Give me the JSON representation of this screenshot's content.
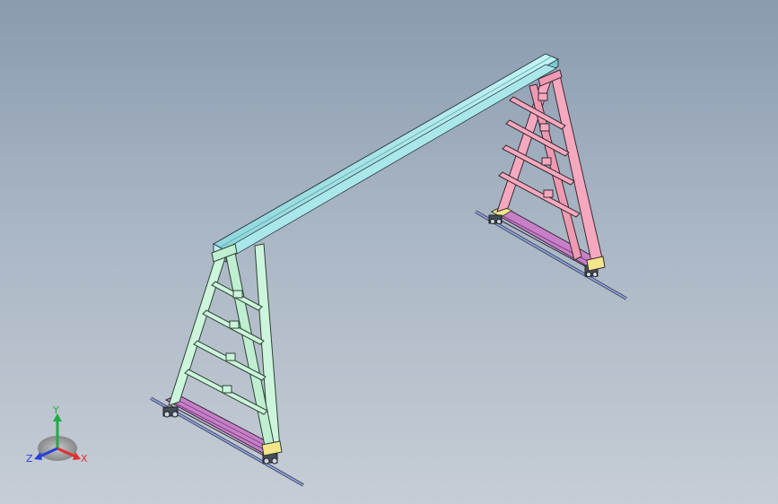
{
  "viewport": {
    "name": "cad-3d-viewport",
    "background_top": "#8a9bb0",
    "background_bottom": "#c6cdd6"
  },
  "model": {
    "beam_color": "#9fe3e6",
    "left_frame_color": "#cdf5dc",
    "right_frame_color": "#f6a9be",
    "base_plate_color": "#c780c8",
    "rail_color": "#8f9ad8",
    "pad_color": "#f2e58a",
    "edge_color": "#2e3e4a"
  },
  "triad": {
    "x_label": "X",
    "y_label": "Y",
    "z_label": "Z",
    "x_color": "#e03030",
    "y_color": "#22aa44",
    "z_color": "#2a3fd8"
  }
}
